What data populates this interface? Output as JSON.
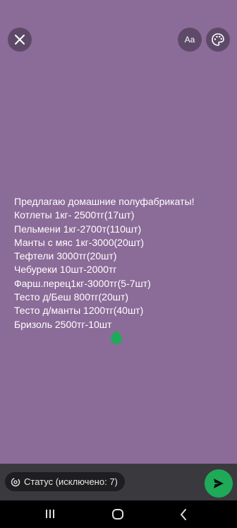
{
  "header": {
    "close_icon": "close-icon",
    "font_button_label": "Aa",
    "palette_icon": "palette-icon"
  },
  "status": {
    "lines": [
      "Предлагаю домашние полуфабрикаты!",
      "Котлеты 1кг- 2500тг(17шт)",
      "Пельмени 1кг-2700т(110шт)",
      "Манты с мяс 1кг-3000(20шт)",
      "Тефтели 3000тг(20шт)",
      "Чебуреки 10шт-2000тг",
      "Фарш.перец1кг-3000тг(5-7шт)",
      "Тесто д/Беш 800тг(20шт)",
      "Тесто д/манты 1200тг(40шт)",
      "Бризоль 2500тг-10шт"
    ]
  },
  "footer": {
    "privacy_label": "Статус (исключено: 7)",
    "send_icon": "send-icon"
  },
  "nav": {
    "recent_icon": "recent-apps-icon",
    "home_icon": "home-icon",
    "back_icon": "back-icon"
  },
  "colors": {
    "background": "#8b6b98",
    "accent": "#1faa59",
    "button_bg": "#5e4a68",
    "bottom_bar": "#3a3a3e"
  }
}
